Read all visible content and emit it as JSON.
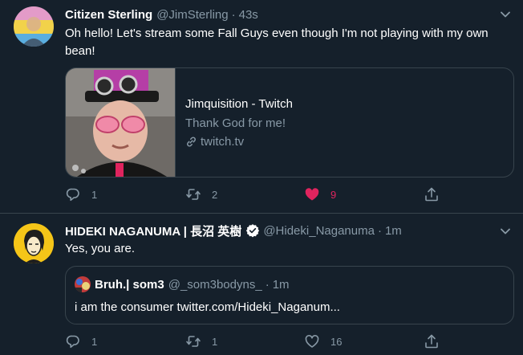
{
  "tweets": [
    {
      "display_name": "Citizen Sterling",
      "handle": "@JimSterling",
      "separator": "·",
      "time": "43s",
      "text": "Oh hello! Let's stream some Fall Guys even though I'm not playing with my own bean!",
      "card": {
        "title": "Jimquisition - Twitch",
        "description": "Thank God for me!",
        "domain": "twitch.tv"
      },
      "replies": "1",
      "retweets": "2",
      "likes": "9",
      "liked": true
    },
    {
      "display_name": "HIDEKI NAGANUMA | 長沼 英樹",
      "handle": "@Hideki_Naganuma",
      "separator": "·",
      "time": "1m",
      "verified": true,
      "text": "Yes, you are.",
      "quote": {
        "display_name": "Bruh.| som3",
        "handle": "@_som3bodyns_",
        "separator": "·",
        "time": "1m",
        "text": "i am the consumer twitter.com/Hideki_Naganum..."
      },
      "replies": "1",
      "retweets": "1",
      "likes": "16",
      "liked": false
    }
  ],
  "colors": {
    "background": "#15202b",
    "border": "#38444d",
    "muted": "#8899a6",
    "like_active": "#e0245e",
    "verified": "#ffffff"
  },
  "icons": [
    "chevron-down-icon",
    "verified-badge-icon",
    "link-icon",
    "reply-icon",
    "retweet-icon",
    "heart-icon",
    "share-icon"
  ]
}
